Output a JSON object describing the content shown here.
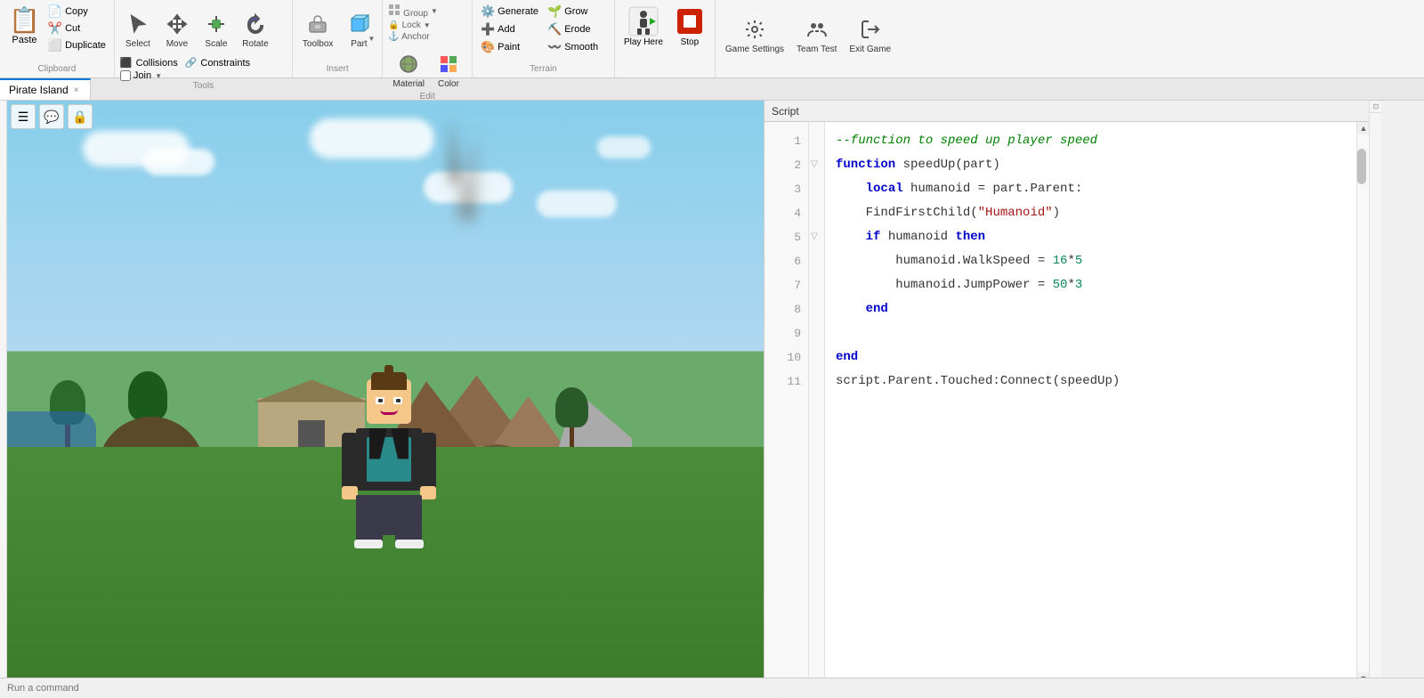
{
  "toolbar": {
    "clipboard": {
      "paste_label": "Paste",
      "copy_label": "Copy",
      "cut_label": "Cut",
      "duplicate_label": "Duplicate",
      "section_label": "Clipboard"
    },
    "tools": {
      "select_label": "Select",
      "move_label": "Move",
      "scale_label": "Scale",
      "rotate_label": "Rotate",
      "collisions_label": "Collisions",
      "constraints_label": "Constraints",
      "join_label": "Join",
      "section_label": "Tools"
    },
    "insert": {
      "toolbox_label": "Toolbox",
      "part_label": "Part",
      "section_label": "Insert"
    },
    "edit": {
      "material_label": "Material",
      "color_label": "Color",
      "group_label": "Group",
      "lock_label": "Lock",
      "anchor_label": "Anchor",
      "section_label": "Edit"
    },
    "terrain": {
      "generate_label": "Generate",
      "grow_label": "Grow",
      "add_label": "Add",
      "erode_label": "Erode",
      "paint_label": "Paint",
      "smooth_label": "Smooth",
      "section_label": "Terrain"
    },
    "play": {
      "play_here_label": "Play Here",
      "stop_label": "Stop"
    },
    "settings": {
      "game_settings_label": "Game Settings",
      "team_test_label": "Team Test",
      "exit_game_label": "Exit Game"
    }
  },
  "tab": {
    "label": "Pirate Island",
    "close": "×"
  },
  "viewport": {
    "icons": [
      "☰",
      "💬",
      "🔒"
    ]
  },
  "script_panel": {
    "header": "Script",
    "lines": [
      {
        "num": 1,
        "fold": false,
        "content": "--function to speed up player speed",
        "type": "comment"
      },
      {
        "num": 2,
        "fold": true,
        "content": "function speedUp(part)",
        "type": "function_def"
      },
      {
        "num": 3,
        "fold": false,
        "content": "    local humanoid = part.Parent:",
        "type": "local"
      },
      {
        "num": 4,
        "fold": false,
        "content": "    FindFirstChild(\"Humanoid\")",
        "type": "method_call"
      },
      {
        "num": 5,
        "fold": true,
        "content": "    if humanoid then",
        "type": "if"
      },
      {
        "num": 6,
        "fold": false,
        "content": "        humanoid.WalkSpeed = 16*5",
        "type": "assignment"
      },
      {
        "num": 7,
        "fold": false,
        "content": "        humanoid.JumpPower = 50*3",
        "type": "assignment"
      },
      {
        "num": 8,
        "fold": false,
        "content": "    end",
        "type": "end"
      },
      {
        "num": 9,
        "fold": false,
        "content": "",
        "type": "empty"
      },
      {
        "num": 10,
        "fold": false,
        "content": "end",
        "type": "end"
      },
      {
        "num": 11,
        "fold": false,
        "content": "script.Parent.Touched:Connect(speedUp)",
        "type": "connect"
      }
    ]
  },
  "bottom_bar": {
    "placeholder": "Run a command"
  },
  "colors": {
    "toolbar_bg": "#f5f5f5",
    "accent_blue": "#0078d4",
    "stop_red": "#cc2200",
    "play_green": "#007700"
  }
}
